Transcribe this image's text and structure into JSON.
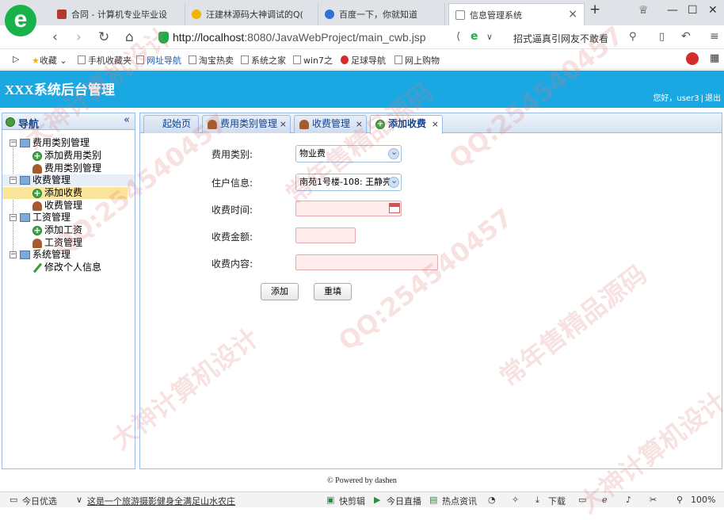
{
  "browser": {
    "tabs": [
      {
        "label": "合同 - 计算机专业毕业设",
        "icon_color": "#b03a2e"
      },
      {
        "label": "汪建林源码大神调试的Q(",
        "icon_color": "#f0b400"
      },
      {
        "label": "百度一下，你就知道",
        "icon_color": "#2f6fd6"
      },
      {
        "label": "信息管理系统",
        "icon_color": "#ffffff",
        "close": "×"
      }
    ],
    "new_tab": "+",
    "url_host": "http://localhost",
    "url_rest": ":8080/JavaWebProject/main_cwb.jsp",
    "search_text": "招式逼真引网友不敢看",
    "bookmarks": [
      "收藏",
      "手机收藏夹",
      "网址导航",
      "淘宝热卖",
      "系统之家",
      "win7之",
      "足球导航",
      "网上购物"
    ]
  },
  "header": {
    "title": "XXX系统后台管理",
    "greeting": "您好，user3",
    "separator": "|",
    "logout": "退出"
  },
  "nav": {
    "title": "导航",
    "collapse": "«",
    "tree": [
      {
        "label": "费用类别管理",
        "children": [
          "添加费用类别",
          "费用类别管理"
        ]
      },
      {
        "label": "收费管理",
        "children": [
          "添加收费",
          "收费管理"
        ]
      },
      {
        "label": "工资管理",
        "children": [
          "添加工资",
          "工资管理"
        ]
      },
      {
        "label": "系统管理",
        "children": [
          "修改个人信息"
        ]
      }
    ]
  },
  "tabs": [
    {
      "label": "起始页"
    },
    {
      "label": "费用类别管理",
      "close": "×"
    },
    {
      "label": "收费管理",
      "close": "×"
    },
    {
      "label": "添加收费",
      "close": "×"
    }
  ],
  "form": {
    "fee_type_label": "费用类别:",
    "fee_type_value": "物业费",
    "resident_label": "住户信息:",
    "resident_value": "南苑1号楼-108: 王静亮",
    "time_label": "收费时间:",
    "amount_label": "收费金额:",
    "content_label": "收费内容:",
    "add_button": "添加",
    "reset_button": "重填"
  },
  "footer": "© Powered by dashen",
  "statusbar": {
    "left": "今日优选",
    "news": "这是一个旅游摄影健身全满足山水农庄",
    "items": [
      "快剪辑",
      "今日直播",
      "热点资讯",
      "下载",
      "100%"
    ]
  },
  "watermarks": [
    "QQ:254540457",
    "常年售精品源码",
    "大神计算机设计"
  ]
}
